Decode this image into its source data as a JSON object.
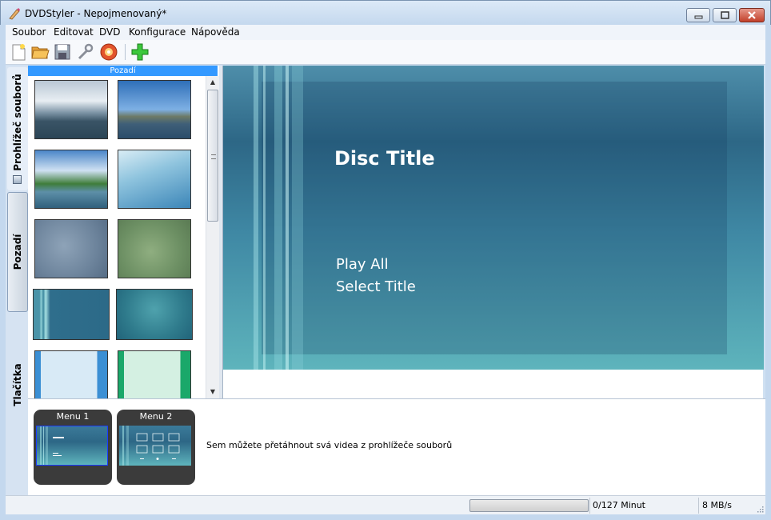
{
  "window": {
    "title": "DVDStyler - Nepojmenovaný*",
    "app_icon": "dvdstyler-icon",
    "controls": [
      "minimize-icon",
      "maximize-icon",
      "close-icon"
    ]
  },
  "menubar": {
    "items": [
      {
        "label": "Soubor"
      },
      {
        "label": "Editovat"
      },
      {
        "label": "DVD"
      },
      {
        "label": "Konfigurace"
      },
      {
        "label": "Nápověda"
      }
    ]
  },
  "toolbar": {
    "buttons": [
      "new-file-icon",
      "open-folder-icon",
      "save-icon",
      "settings-wrench-icon",
      "burn-disc-icon",
      "add-icon"
    ]
  },
  "side_tabs": {
    "items": [
      {
        "label": "Prohlížeč souborů",
        "icon": "file-browser-icon"
      },
      {
        "label": "Pozadí"
      },
      {
        "label": "Tlačítka"
      }
    ]
  },
  "backgrounds_panel": {
    "header": "Pozadí",
    "thumbnails": [
      "sea-island",
      "ship-on-water",
      "lake-shore",
      "blue-mist",
      "blue-gray-blur",
      "green-blur",
      "teal-stripes",
      "teal-texture",
      "light-blue-bars",
      "mint-green-bars"
    ]
  },
  "preview": {
    "disc_title": "Disc Title",
    "buttons": [
      "Play All",
      "Select Title"
    ],
    "colors": {
      "text": "#ffffff",
      "bg_top": "#2d6786",
      "bg_bottom": "#5eb4bc"
    }
  },
  "titleset": {
    "menus": [
      {
        "label": "Menu 1"
      },
      {
        "label": "Menu 2"
      }
    ],
    "hint": "Sem můžete přetáhnout svá videa z prohlížeče souborů"
  },
  "statusbar": {
    "minutes": "0/127 Minut",
    "speed": "8 MB/s"
  }
}
